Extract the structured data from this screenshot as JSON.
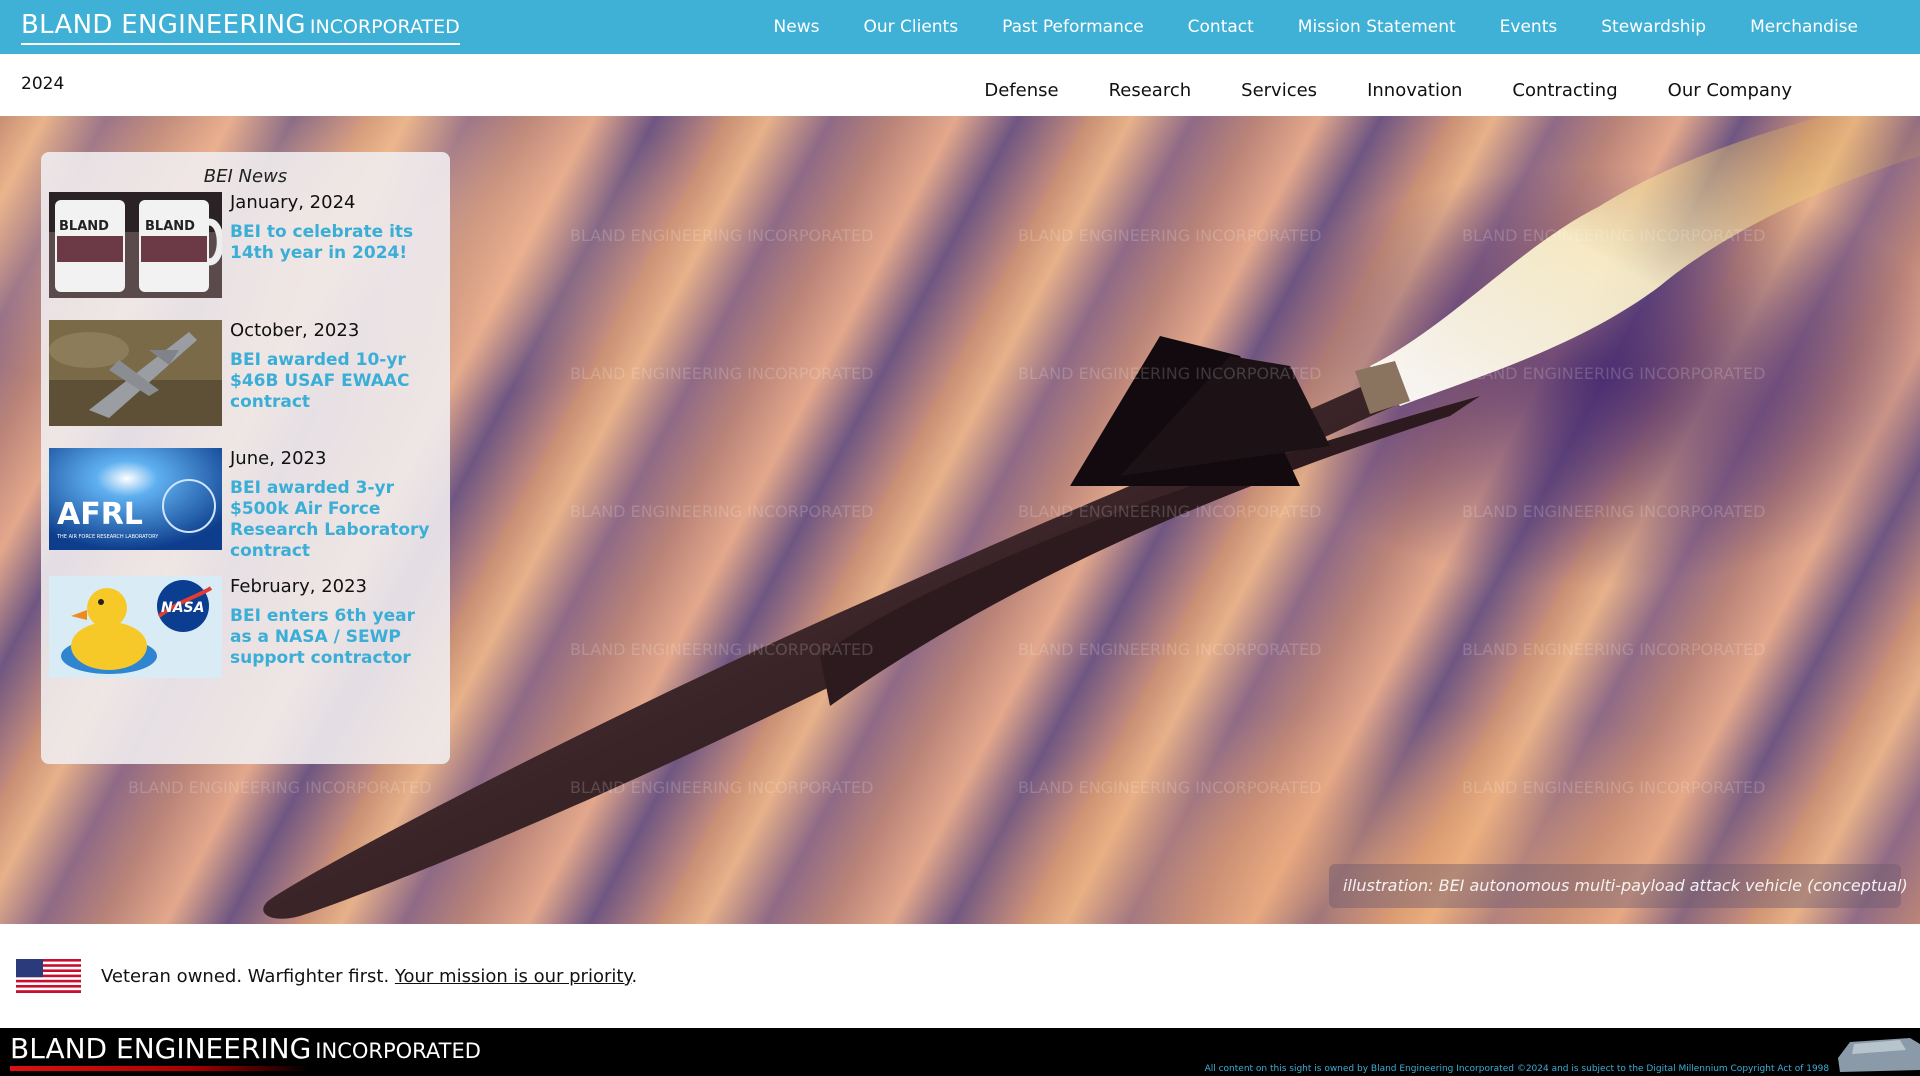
{
  "header": {
    "brand_main": "BLAND ENGINEERING",
    "brand_sub": "INCORPORATED",
    "nav": [
      "News",
      "Our Clients",
      "Past Peformance",
      "Contact",
      "Mission Statement",
      "Events",
      "Stewardship",
      "Merchandise"
    ]
  },
  "subheader": {
    "year": "2024",
    "nav": [
      "Defense",
      "Research",
      "Services",
      "Innovation",
      "Contracting",
      "Our Company"
    ]
  },
  "hero": {
    "watermark": "BLAND ENGINEERING INCORPORATED",
    "caption": "illustration: BEI autonomous multi-payload attack vehicle (conceptual)"
  },
  "news": {
    "title": "BEI News",
    "items": [
      {
        "date": "January, 2024",
        "headline": "BEI to celebrate its 14th year in 2024!",
        "thumb_icon": "mugs-photo-icon"
      },
      {
        "date": "October, 2023",
        "headline": "BEI awarded 10-yr $46B USAF EWAAC contract",
        "thumb_icon": "fighter-jet-photo-icon"
      },
      {
        "date": "June, 2023",
        "headline": "BEI awarded 3-yr $500k Air Force Research Laboratory contract",
        "thumb_icon": "afrl-logo-icon"
      },
      {
        "date": "February, 2023",
        "headline": "BEI enters 6th year as a NASA / SEWP support contractor",
        "thumb_icon": "rubber-duck-nasa-icon"
      }
    ],
    "mug_label": "BLAND",
    "afrl_label": "AFRL",
    "afrl_sub": "THE AIR FORCE RESEARCH LABORATORY",
    "nasa_label": "NASA"
  },
  "tagline": {
    "part1": "Veteran owned.  Warfighter first.  ",
    "link": "Your mission is our priority",
    "end": "."
  },
  "footer": {
    "brand_main": "BLAND ENGINEERING",
    "brand_sub": "INCORPORATED",
    "copyright": "All content on this sight is owned by Bland Engineering Incorporated ©2024 and is subject to the Digital Millennium Copyright Act of 1998."
  },
  "colors": {
    "topbar": "#3fb1d6",
    "link_blue": "#3aaed6",
    "footer": "#000000"
  }
}
